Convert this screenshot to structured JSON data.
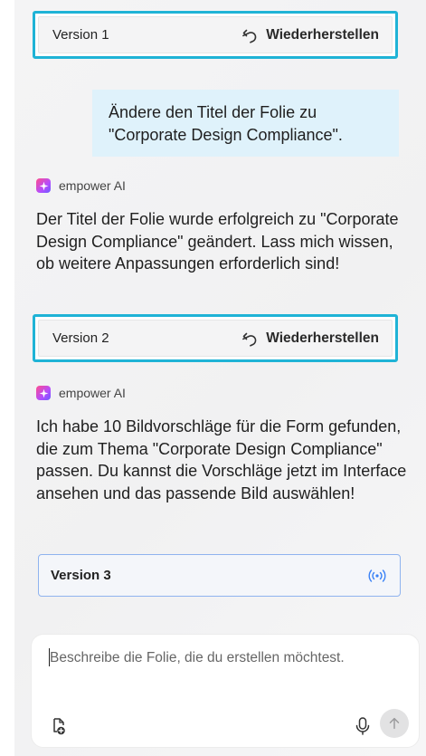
{
  "messages": {
    "version1": {
      "label": "Version 1",
      "restore_label": "Wiederherstellen"
    },
    "user_message": "Ändere den Titel der Folie zu \"Corporate Design Compliance\".",
    "ai_reply_1": {
      "sender": "empower AI",
      "text": "Der Titel der Folie wurde erfolgreich zu \"Corporate Design Compliance\" geändert. Lass mich wissen, ob weitere Anpassungen erforderlich sind!"
    },
    "version2": {
      "label": "Version 2",
      "restore_label": "Wiederherstellen"
    },
    "ai_reply_2": {
      "sender": "empower AI",
      "text": "Ich habe 10 Bildvorschläge für die Form gefunden, die zum Thema \"Corporate Design Compliance\" passen. Du kannst die Vorschläge jetzt im Interface ansehen und das passende Bild auswählen!"
    },
    "version3": {
      "label": "Version 3",
      "status_icon": "live-broadcast-icon"
    }
  },
  "composer": {
    "placeholder": "Beschreibe die Folie, die du erstellen möchtest.",
    "value": ""
  },
  "icons": {
    "restore": "undo-arrow-icon",
    "attach": "add-file-icon",
    "mic": "microphone-icon",
    "send": "arrow-up-icon"
  },
  "colors": {
    "highlight_border": "#1fb3d6",
    "user_bubble": "#dff2fb",
    "accent_blue": "#3b82f6"
  }
}
